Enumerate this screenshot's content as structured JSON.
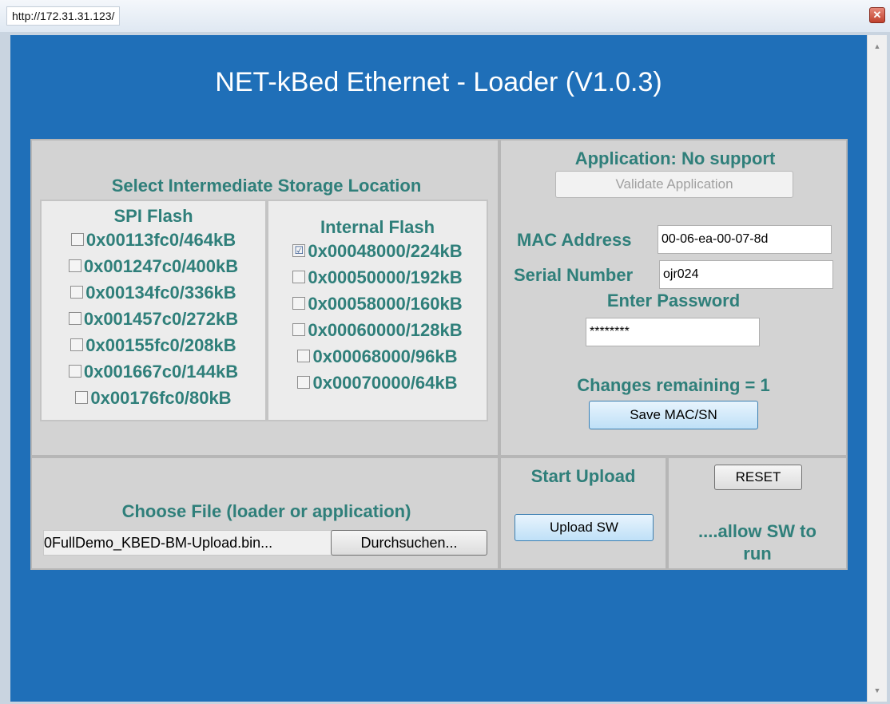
{
  "window": {
    "url": "http://172.31.31.123/",
    "close_glyph": "✕"
  },
  "page": {
    "title": "NET-kBed Ethernet - Loader (V1.0.3)"
  },
  "storage": {
    "title": "Select Intermediate Storage Location",
    "spi": {
      "title": "SPI Flash",
      "options": [
        {
          "label": "0x00113fc0/464kB",
          "checked": false
        },
        {
          "label": "0x001247c0/400kB",
          "checked": false
        },
        {
          "label": "0x00134fc0/336kB",
          "checked": false
        },
        {
          "label": "0x001457c0/272kB",
          "checked": false
        },
        {
          "label": "0x00155fc0/208kB",
          "checked": false
        },
        {
          "label": "0x001667c0/144kB",
          "checked": false
        },
        {
          "label": "0x00176fc0/80kB",
          "checked": false
        }
      ]
    },
    "internal": {
      "title": "Internal Flash",
      "options": [
        {
          "label": "0x00048000/224kB",
          "checked": true
        },
        {
          "label": "0x00050000/192kB",
          "checked": false
        },
        {
          "label": "0x00058000/160kB",
          "checked": false
        },
        {
          "label": "0x00060000/128kB",
          "checked": false
        },
        {
          "label": "0x00068000/96kB",
          "checked": false
        },
        {
          "label": "0x00070000/64kB",
          "checked": false
        }
      ]
    }
  },
  "application": {
    "status": "Application: No support",
    "validate_label": "Validate Application",
    "mac_label": "MAC Address",
    "mac_value": "00-06-ea-00-07-8d",
    "serial_label": "Serial Number",
    "serial_value": "ojr024",
    "password_label": "Enter Password",
    "password_value": "********",
    "changes_remaining": "Changes remaining = 1",
    "save_label": "Save MAC/SN"
  },
  "file": {
    "title": "Choose File (loader or application)",
    "path": "...0FullDemo_KBED-BM-Upload.bin",
    "browse_label": "Durchsuchen..."
  },
  "upload": {
    "title": "Start Upload",
    "button_label": "Upload SW"
  },
  "reset": {
    "button_label": "RESET",
    "note": "....allow SW to run"
  },
  "colors": {
    "background": "#1f6fb8",
    "panel": "#d3d3d3",
    "teal_text": "#2f7f7a"
  },
  "icons": {
    "checkbox_check": "☑",
    "scroll_up": "▲",
    "scroll_down": "▼"
  }
}
